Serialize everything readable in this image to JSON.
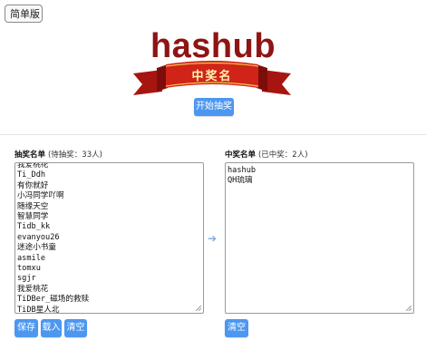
{
  "header": {
    "version_select": {
      "selected": "简单版"
    },
    "title": "hashub",
    "banner_text": "中奖名",
    "start_button": "开始抽奖"
  },
  "left_panel": {
    "label": "抽奖名单",
    "sub_label": "(待抽奖：33人)",
    "names": [
      "我爱桃花",
      "Ti_Ddh",
      "有你就好",
      "小冯同学吖啊",
      "随缘天空",
      "智慧同学",
      "Tidb_kk",
      "evanyou26",
      "迷途小书童",
      "asmile",
      "tomxu",
      "sgjr",
      "我爱桃花",
      "TiDBer_磁场的救赎",
      "TiDB星人北"
    ],
    "buttons": [
      "保存",
      "载入",
      "清空"
    ]
  },
  "right_panel": {
    "label": "中奖名单",
    "sub_label": "(已中奖：2人)",
    "names": [
      "hashub",
      "QH琉璃"
    ],
    "buttons": [
      "清空"
    ]
  },
  "icons": {
    "arrow": "arrow-right-icon",
    "chevron": "chevron-down-icon"
  },
  "colors": {
    "title": "#8f1414",
    "button": "#4c97f0",
    "ribbon": "#c41f18"
  }
}
